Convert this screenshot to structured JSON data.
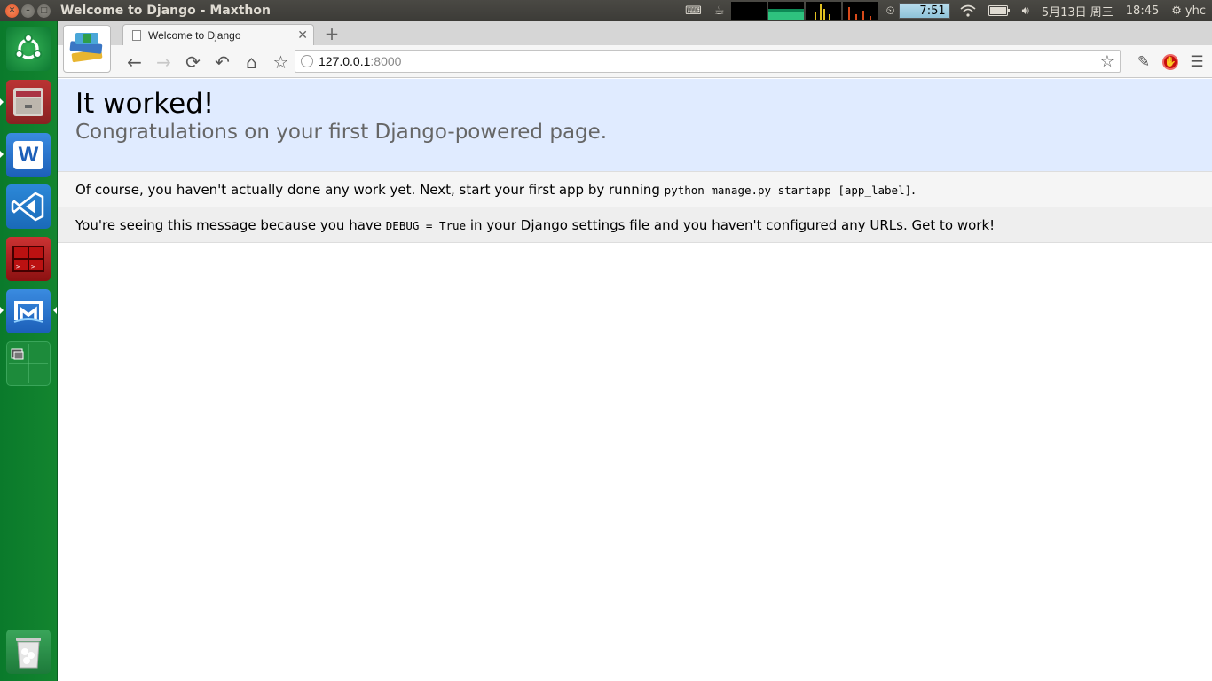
{
  "top_panel": {
    "window_title": "Welcome to Django - Maxthon",
    "timer": "7:51",
    "date": "5月13日 周三",
    "time": "18:45",
    "user": "yhc"
  },
  "launcher": {
    "items": [
      "dash-home",
      "files",
      "wps-writer",
      "visual-studio-code",
      "terminal-multiplexer",
      "maxthon-browser",
      "workspace-switcher",
      "trash"
    ]
  },
  "browser": {
    "tab_title": "Welcome to Django",
    "new_tab": "+",
    "address_host": "127.0.0.1",
    "address_port": ":8000"
  },
  "page": {
    "heading": "It worked!",
    "subheading": "Congratulations on your first Django-powered page.",
    "msg1_text": "Of course, you haven't actually done any work yet. Next, start your first app by running ",
    "msg1_code": "python manage.py startapp [app_label]",
    "msg1_end": ".",
    "msg2_text_a": "You're seeing this message because you have ",
    "msg2_code": "DEBUG = True",
    "msg2_text_b": " in your Django settings file and you haven't configured any URLs. Get to work!"
  }
}
